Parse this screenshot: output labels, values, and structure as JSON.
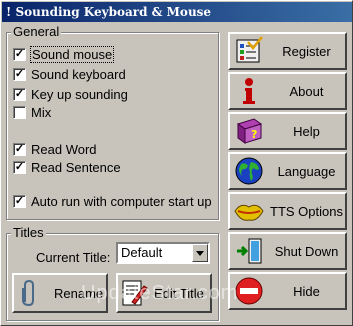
{
  "window": {
    "title": "! Sounding Keyboard & Mouse"
  },
  "general": {
    "label": "General",
    "options": [
      {
        "label": "Sound mouse",
        "checked": true
      },
      {
        "label": "Sound keyboard",
        "checked": true
      },
      {
        "label": "Key up sounding",
        "checked": true
      },
      {
        "label": "Mix",
        "checked": false
      },
      {
        "label": "Read Word",
        "checked": true
      },
      {
        "label": "Read Sentence",
        "checked": true
      },
      {
        "label": "Auto run with computer start up",
        "checked": true
      }
    ]
  },
  "titles": {
    "label": "Titles",
    "current_label": "Current Title:",
    "current_value": "Default",
    "rename_label": "Rename",
    "edit_label": "Edit Title"
  },
  "commands": [
    {
      "label": "Register",
      "icon": "register-icon"
    },
    {
      "label": "About",
      "icon": "info-icon"
    },
    {
      "label": "Help",
      "icon": "help-book-icon"
    },
    {
      "label": "Language",
      "icon": "globe-icon"
    },
    {
      "label": "TTS Options",
      "icon": "lips-icon"
    },
    {
      "label": "Shut Down",
      "icon": "exit-door-icon"
    },
    {
      "label": "Hide",
      "icon": "hide-icon"
    }
  ],
  "watermark": "UpdateStar.com",
  "colors": {
    "title_start": "#0a246a",
    "title_end": "#3a6ea5",
    "face": "#c8c4bc"
  }
}
